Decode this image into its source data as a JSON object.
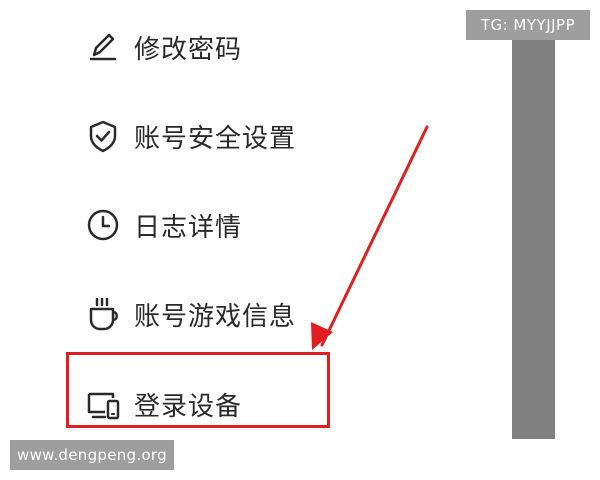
{
  "menu": {
    "items": [
      {
        "id": "change-password",
        "label": "修改密码",
        "icon": "pencil-icon"
      },
      {
        "id": "account-security",
        "label": "账号安全设置",
        "icon": "shield-check-icon"
      },
      {
        "id": "log-details",
        "label": "日志详情",
        "icon": "clock-icon"
      },
      {
        "id": "game-info",
        "label": "账号游戏信息",
        "icon": "coffee-cup-icon"
      },
      {
        "id": "login-devices",
        "label": "登录设备",
        "icon": "devices-icon"
      }
    ]
  },
  "watermarks": {
    "top": "TG: MYYJJPP",
    "bottom": "www.dengpeng.org"
  },
  "colors": {
    "highlight": "#e02020",
    "gray_bar": "#808080",
    "watermark_bg": "#9e9e9e",
    "text": "#2a2a2a"
  }
}
